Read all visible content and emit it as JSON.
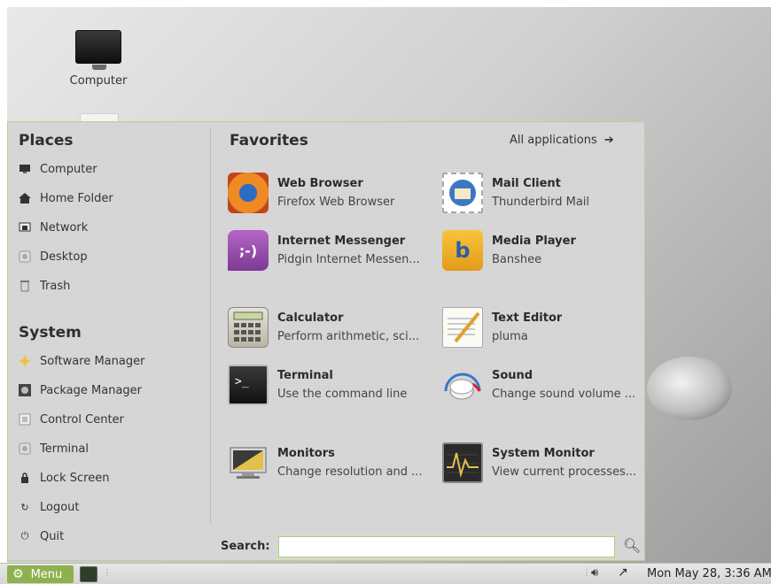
{
  "desktop": {
    "icon_label": "Computer"
  },
  "menu": {
    "places": {
      "title": "Places",
      "items": [
        {
          "label": "Computer",
          "icon": "computer-icon"
        },
        {
          "label": "Home Folder",
          "icon": "home-icon"
        },
        {
          "label": "Network",
          "icon": "network-icon"
        },
        {
          "label": "Desktop",
          "icon": "desktop-icon"
        },
        {
          "label": "Trash",
          "icon": "trash-icon"
        }
      ]
    },
    "system": {
      "title": "System",
      "items": [
        {
          "label": "Software Manager",
          "icon": "software-manager-icon"
        },
        {
          "label": "Package Manager",
          "icon": "package-manager-icon"
        },
        {
          "label": "Control Center",
          "icon": "control-center-icon"
        },
        {
          "label": "Terminal",
          "icon": "terminal-icon"
        },
        {
          "label": "Lock Screen",
          "icon": "lock-icon"
        },
        {
          "label": "Logout",
          "icon": "logout-icon"
        },
        {
          "label": "Quit",
          "icon": "power-icon"
        }
      ]
    },
    "favorites": {
      "title": "Favorites",
      "all_apps": "All applications",
      "apps": [
        {
          "name": "Web Browser",
          "desc": "Firefox Web Browser",
          "icon": "firefox-icon"
        },
        {
          "name": "Mail Client",
          "desc": "Thunderbird Mail",
          "icon": "thunderbird-icon"
        },
        {
          "name": "Internet Messenger",
          "desc": "Pidgin Internet Messen...",
          "icon": "pidgin-icon"
        },
        {
          "name": "Media Player",
          "desc": "Banshee",
          "icon": "banshee-icon"
        },
        {
          "name": "Calculator",
          "desc": "Perform arithmetic, sci...",
          "icon": "calculator-icon"
        },
        {
          "name": "Text Editor",
          "desc": "pluma",
          "icon": "text-editor-icon"
        },
        {
          "name": "Terminal",
          "desc": "Use the command line",
          "icon": "terminal-app-icon"
        },
        {
          "name": "Sound",
          "desc": "Change sound volume ...",
          "icon": "sound-icon"
        },
        {
          "name": "Monitors",
          "desc": "Change resolution and ...",
          "icon": "monitors-icon"
        },
        {
          "name": "System Monitor",
          "desc": "View current processes...",
          "icon": "system-monitor-icon"
        }
      ]
    },
    "search": {
      "label": "Search:",
      "value": ""
    }
  },
  "panel": {
    "menu_label": "Menu",
    "clock": "Mon May 28,  3:36 AM"
  },
  "colors": {
    "accent": "#8fb04f",
    "menu_border": "#b9cf9a"
  }
}
